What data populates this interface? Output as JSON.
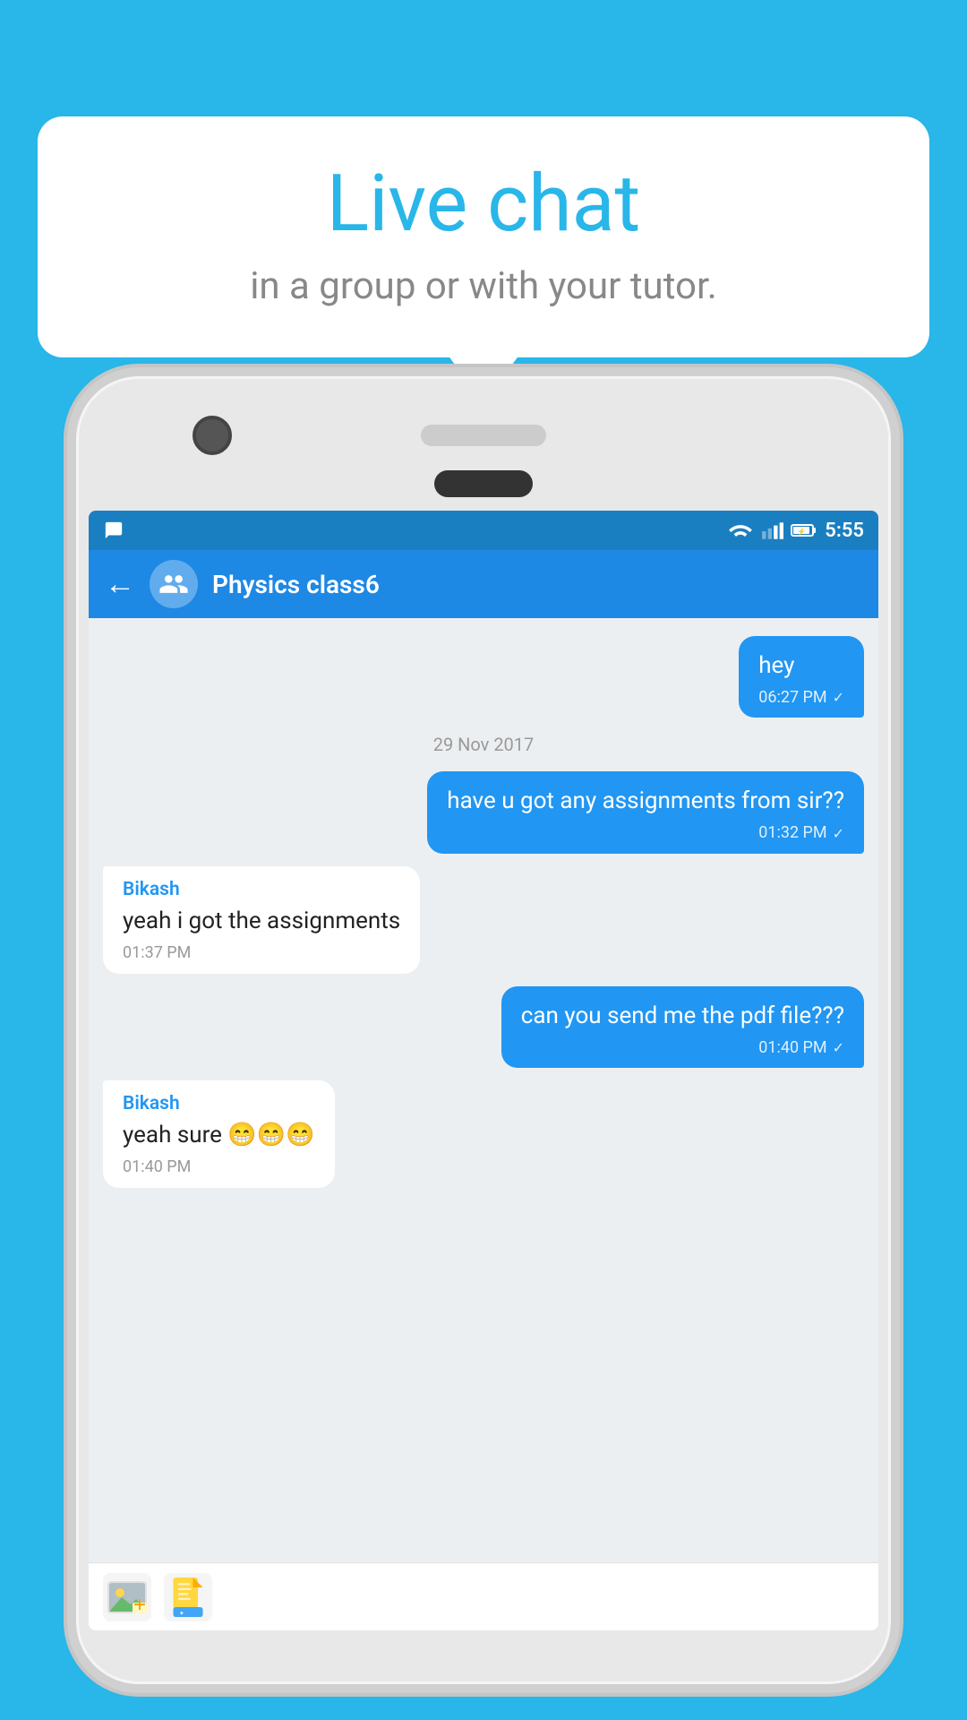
{
  "bubble": {
    "title": "Live chat",
    "subtitle": "in a group or with your tutor."
  },
  "status_bar": {
    "time": "5:55"
  },
  "app_bar": {
    "title": "Physics class6"
  },
  "messages": [
    {
      "type": "sent",
      "text": "hey",
      "time": "06:27 PM",
      "check": "✓"
    },
    {
      "type": "divider",
      "text": "29  Nov  2017"
    },
    {
      "type": "sent",
      "text": "have u got any assignments from sir??",
      "time": "01:32 PM",
      "check": "✓"
    },
    {
      "type": "received",
      "sender": "Bikash",
      "text": "yeah i got the assignments",
      "time": "01:37 PM"
    },
    {
      "type": "sent",
      "text": "can you send me the pdf file???",
      "time": "01:40 PM",
      "check": "✓"
    },
    {
      "type": "received",
      "sender": "Bikash",
      "text": "yeah sure 😁😁😁",
      "time": "01:40 PM"
    }
  ]
}
